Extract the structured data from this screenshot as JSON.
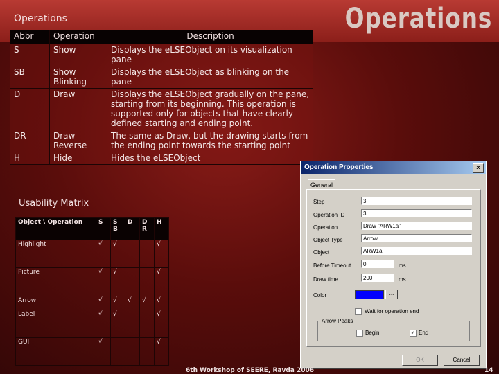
{
  "slide": {
    "subtitle": "Operations",
    "title": "Operations",
    "footer": "6th Workshop of SEERE, Ravda 2006",
    "page_number": "14"
  },
  "ops_table": {
    "headers": [
      "Abbr",
      "Operation",
      "Description"
    ],
    "rows": [
      {
        "abbr": "S",
        "op": "Show",
        "desc": "Displays the eLSEObject on its visualization pane"
      },
      {
        "abbr": "SB",
        "op": "Show Blinking",
        "desc": "Displays the eLSEObject as blinking on the pane"
      },
      {
        "abbr": "D",
        "op": "Draw",
        "desc": "Displays the eLSEObject gradually on the pane, starting from its beginning. This operation is supported only for objects that have clearly defined starting and ending point."
      },
      {
        "abbr": "DR",
        "op": "Draw Reverse",
        "desc": "The same as Draw, but the drawing starts from the ending point towards the starting point"
      },
      {
        "abbr": "H",
        "op": "Hide",
        "desc": "Hides the eLSEObject"
      }
    ]
  },
  "usability": {
    "title": "Usability Matrix",
    "header": [
      "Object \\ Operation",
      "S",
      "S B",
      "D",
      "D R",
      "H"
    ],
    "rows": [
      {
        "obj": "Highlight",
        "marks": [
          "√",
          "√",
          "",
          "",
          "√"
        ]
      },
      {
        "obj": "Picture",
        "marks": [
          "√",
          "√",
          "",
          "",
          "√"
        ]
      },
      {
        "obj": "Arrow",
        "marks": [
          "√",
          "√",
          "√",
          "√",
          "√"
        ]
      },
      {
        "obj": "Label",
        "marks": [
          "√",
          "√",
          "",
          "",
          "√"
        ]
      },
      {
        "obj": "GUI",
        "marks": [
          "√",
          "",
          "",
          "",
          "√"
        ]
      }
    ]
  },
  "dialog": {
    "title": "Operation Properties",
    "close": "×",
    "tab": "General",
    "fields": {
      "step_label": "Step",
      "step_value": "3",
      "opid_label": "Operation ID",
      "opid_value": "3",
      "operation_label": "Operation",
      "operation_value": "Draw \"ARW1a\"",
      "objtype_label": "Object Type",
      "objtype_value": "Arrow",
      "object_label": "Object",
      "object_value": "ARW1a",
      "before_label": "Before Timeout",
      "before_value": "0",
      "before_unit": "ms",
      "draw_label": "Draw time",
      "draw_value": "200",
      "draw_unit": "ms",
      "color_label": "Color",
      "color_value": "#0000ff",
      "color_btn": "..."
    },
    "wait_label": "Wait for operation end",
    "wait_checked": false,
    "arrow_peaks_label": "Arrow Peaks",
    "begin_label": "Begin",
    "begin_checked": false,
    "end_label": "End",
    "end_checked": true,
    "ok_label": "OK",
    "cancel_label": "Cancel"
  },
  "colors": {
    "accent": "#8c1f1a",
    "dialog_bg": "#d4d0c8",
    "titlebar": "#0a246a"
  }
}
